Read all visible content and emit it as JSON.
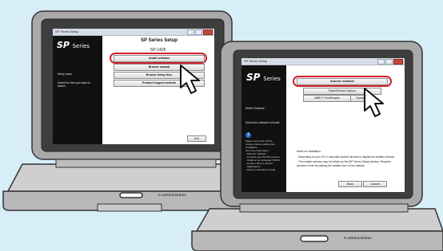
{
  "colors": {
    "background": "#d7eef9",
    "laptop_body": "#c9c9c9",
    "highlight_ring": "#d0202a",
    "sidebar": "#111111"
  },
  "laptop_back": {
    "window_title": "SP Series Setup",
    "logo_sp": "SP",
    "logo_series": "Series",
    "side_label": "Setup menu",
    "side_hint": "Select the item you want to launch.",
    "title": "SP Series Setup",
    "model": "SP-1425",
    "buttons": [
      "Install software",
      "Browse manual",
      "Browse Setup Disc",
      "Product Support website"
    ],
    "exit_label": "Exit",
    "badge": "FI-SERIES/SERIES"
  },
  "laptop_front": {
    "window_title": "SP Series Setup",
    "logo_sp": "SP",
    "logo_series": "Series",
    "side_label": "Select Software",
    "side_hint": "Select the software to install.",
    "sidebar_notes": [
      "Make sure to turn off the",
      "scanner before starting the",
      "installation.",
      "For more information:",
      "- Scanner software",
      "- Connect your PC/TIF scanner",
      "- Install or are activated TWAIN",
      "- scanner drivers product",
      "- Applications",
      "- Refer to Operator's Guide."
    ],
    "buttons": [
      "Scanner software",
      "PaperStream Capture",
      "ABBYY FineReader",
      "Sprint"
    ],
    "notes_heading": "Notes on Installation:",
    "notes": [
      "- Depending on your OS, it may take several minutes to display the installer window.",
      "- The installer window may be hidden by the [SP Series Setup] window. Bring the",
      "  window to front by clicking the installer icon on the taskbar."
    ],
    "back_label": "Back",
    "cancel_label": "Cancel",
    "badge": "FI-SERIES/SERIES"
  }
}
